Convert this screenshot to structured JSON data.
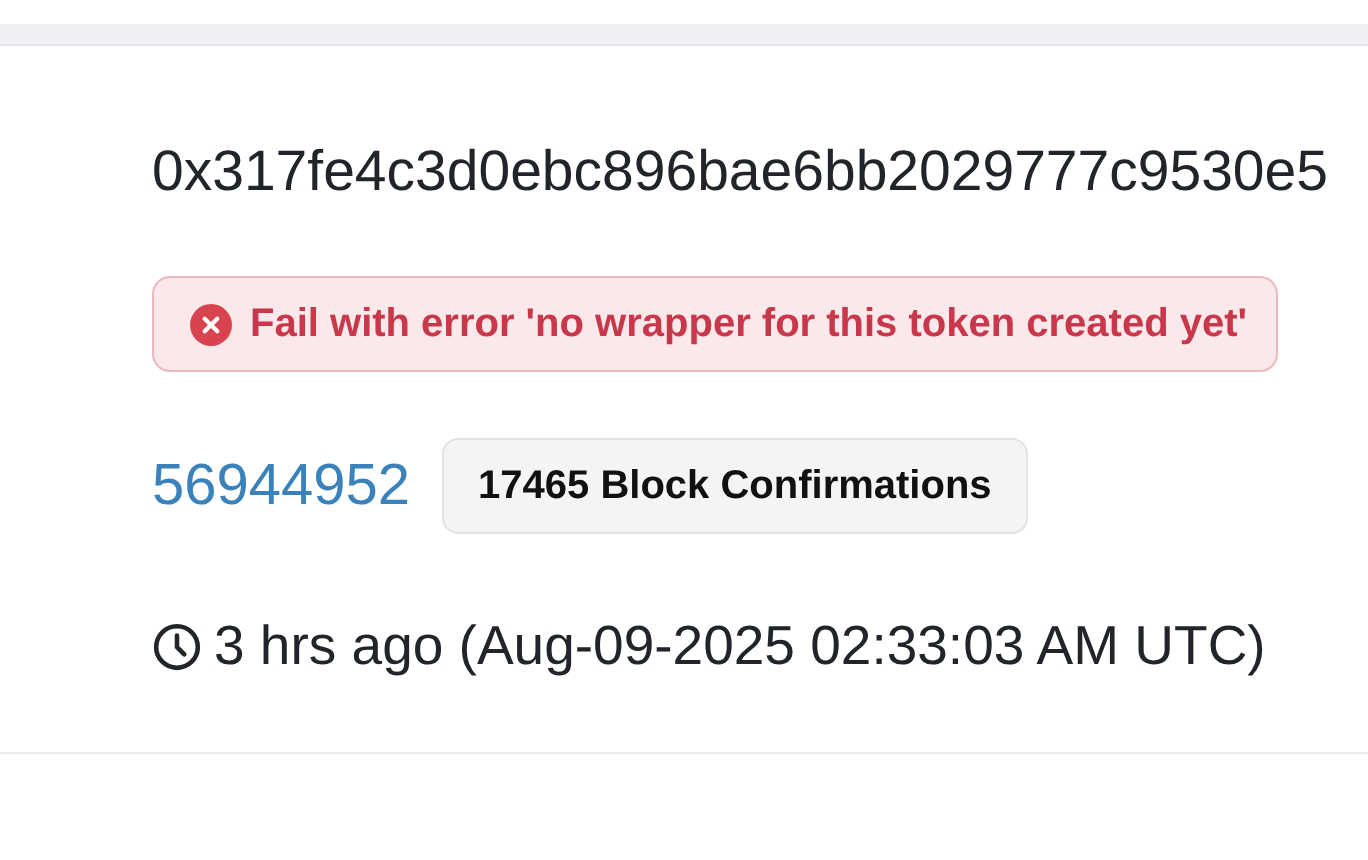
{
  "transaction_hash": "0x317fe4c3d0ebc896bae6bb2029777c9530e5",
  "status": {
    "kind": "error",
    "message": "Fail with error 'no wrapper for this token created yet'"
  },
  "block": {
    "number": "56944952",
    "confirmations": "17465 Block Confirmations"
  },
  "timestamp": "3 hrs ago (Aug-09-2025 02:33:03 AM UTC)"
}
